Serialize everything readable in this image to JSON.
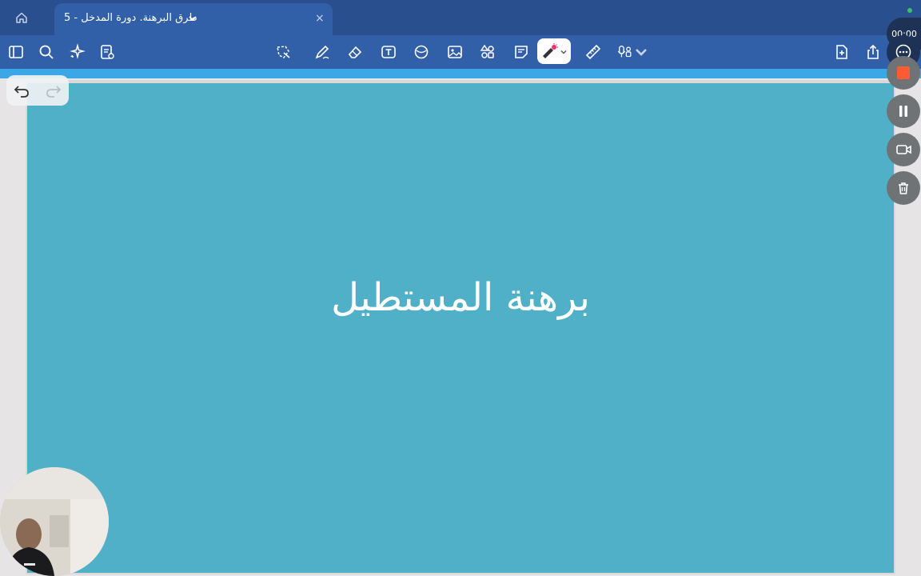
{
  "tab": {
    "title": "طرق البرهنة. دورة المدخل - 5",
    "close_glyph": "×"
  },
  "toolbar": {
    "left_icons": [
      "sidebar-icon",
      "search-icon",
      "ai-sparkle-icon",
      "notes-settings-icon"
    ],
    "center_icons": [
      "lasso-icon",
      "pen-icon",
      "eraser-icon",
      "text-box-icon",
      "shape-icon",
      "image-icon",
      "elements-icon",
      "sticky-note-icon",
      "laser-pointer-icon",
      "ruler-icon",
      "audio-record-icon"
    ],
    "right_icons": [
      "add-page-icon",
      "share-icon",
      "more-icon"
    ]
  },
  "slide": {
    "title": "برهنة المستطيل",
    "background": "#50b0c8"
  },
  "recording": {
    "timer": "00:00",
    "stop_color": "#ff5a36"
  },
  "colors": {
    "accent": "#3160a8",
    "tabbar": "#294f8f",
    "progress": "#3ca7e6"
  }
}
